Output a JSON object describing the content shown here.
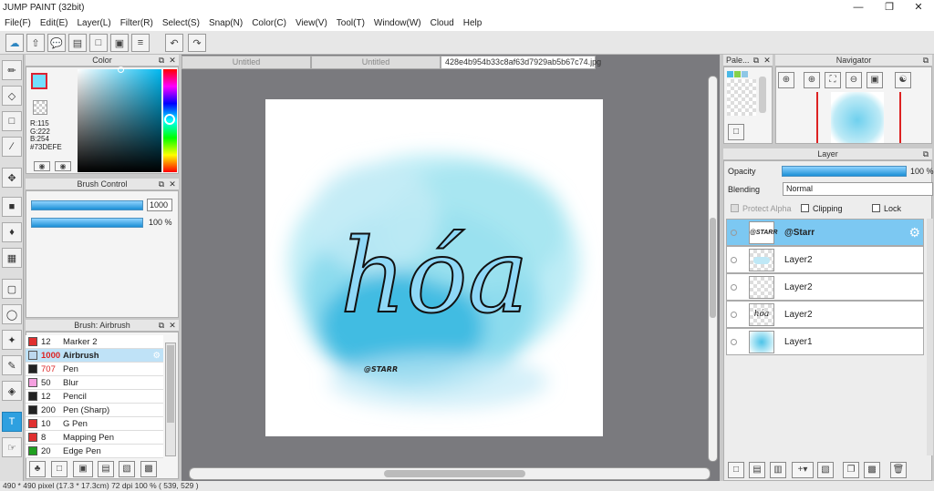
{
  "window": {
    "title": "JUMP PAINT (32bit)"
  },
  "menu": [
    "File(F)",
    "Edit(E)",
    "Layer(L)",
    "Filter(R)",
    "Select(S)",
    "Snap(N)",
    "Color(C)",
    "View(V)",
    "Tool(T)",
    "Window(W)",
    "Cloud",
    "Help"
  ],
  "color_panel": {
    "title": "Color",
    "r": "R:115",
    "g": "G:222",
    "b": "B:254",
    "hex": "#73DEFE",
    "main_color": "#73DEFE"
  },
  "brush_control": {
    "title": "Brush Control",
    "size": "1000",
    "opacity": "100 %"
  },
  "brush_panel": {
    "title": "Brush: Airbrush",
    "items": [
      {
        "size": "12",
        "name": "Marker 2",
        "color": "#e03030"
      },
      {
        "size": "1000",
        "name": "Airbrush",
        "color": "#bcd8ee",
        "selected": true
      },
      {
        "size": "707",
        "name": "Pen",
        "color": "#222222"
      },
      {
        "size": "50",
        "name": "Blur",
        "color": "#f5a0e0"
      },
      {
        "size": "12",
        "name": "Pencil",
        "color": "#222222"
      },
      {
        "size": "200",
        "name": "Pen (Sharp)",
        "color": "#222222"
      },
      {
        "size": "10",
        "name": "G Pen",
        "color": "#e03030"
      },
      {
        "size": "8",
        "name": "Mapping Pen",
        "color": "#e03030"
      },
      {
        "size": "20",
        "name": "Edge Pen",
        "color": "#20a020"
      }
    ]
  },
  "tabs": [
    {
      "label": "Untitled"
    },
    {
      "label": "Untitled"
    },
    {
      "label": "428e4b954b33c8af63d7929ab5b67c74.jpg"
    }
  ],
  "artwork": {
    "text": "hóa",
    "signature": "@STARR"
  },
  "palette_panel": {
    "title": "Pale..."
  },
  "navigator_panel": {
    "title": "Navigator"
  },
  "layer_panel": {
    "title": "Layer",
    "opacity_label": "Opacity",
    "opacity_value": "100 %",
    "blending_label": "Blending",
    "blending_value": "Normal",
    "protect_alpha": "Protect Alpha",
    "clipping": "Clipping",
    "lock": "Lock",
    "layers": [
      {
        "name": "@Starr",
        "selected": true
      },
      {
        "name": "Layer2"
      },
      {
        "name": "Layer2"
      },
      {
        "name": "Layer2"
      },
      {
        "name": "Layer1"
      }
    ]
  },
  "status": {
    "text": "490 * 490 pixel  (17.3 * 17.3cm)  72 dpi  100 %  ( 539, 529 )"
  }
}
